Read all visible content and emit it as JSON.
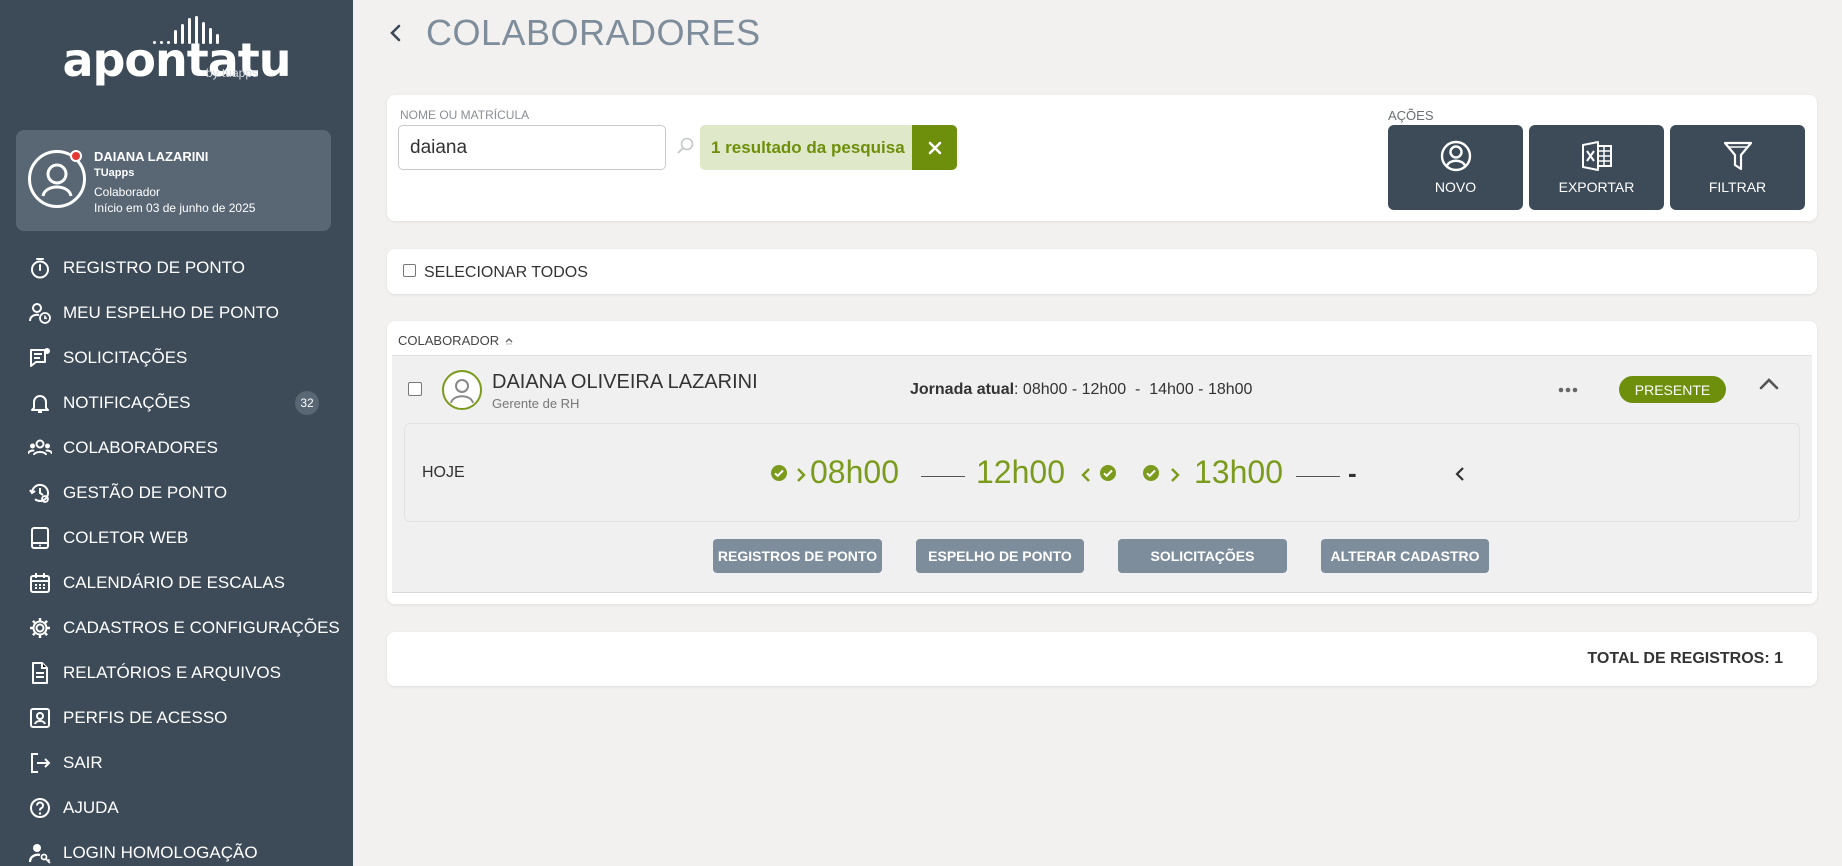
{
  "sidebar": {
    "logo_text": "apontatu",
    "logo_by": "by tuapps",
    "user": {
      "name": "DAIANA LAZARINI",
      "company": "TUapps",
      "role": "Colaborador",
      "since": "Início em 03 de junho de 2025"
    },
    "items": [
      {
        "label": "REGISTRO DE PONTO",
        "icon": "stopwatch-icon"
      },
      {
        "label": "MEU ESPELHO DE PONTO",
        "icon": "user-clock-icon"
      },
      {
        "label": "SOLICITAÇÕES",
        "icon": "request-icon"
      },
      {
        "label": "NOTIFICAÇÕES",
        "icon": "bell-icon",
        "badge": "32"
      },
      {
        "label": "COLABORADORES",
        "icon": "team-icon"
      },
      {
        "label": "GESTÃO DE PONTO",
        "icon": "clock-gear-icon"
      },
      {
        "label": "COLETOR WEB",
        "icon": "tablet-icon"
      },
      {
        "label": "CALENDÁRIO DE ESCALAS",
        "icon": "calendar-icon"
      },
      {
        "label": "CADASTROS E CONFIGURAÇÕES",
        "icon": "gear-icon"
      },
      {
        "label": "RELATÓRIOS E ARQUIVOS",
        "icon": "document-icon"
      },
      {
        "label": "PERFIS DE ACESSO",
        "icon": "id-card-icon"
      },
      {
        "label": "SAIR",
        "icon": "logout-icon"
      },
      {
        "label": "AJUDA",
        "icon": "help-icon"
      },
      {
        "label": "LOGIN HOMOLOGAÇÃO",
        "icon": "user-key-icon"
      }
    ]
  },
  "header": {
    "title": "COLABORADORES"
  },
  "search": {
    "label": "NOME OU MATRÍCULA",
    "value": "daiana",
    "result_text": "1 resultado da pesquisa"
  },
  "actions": {
    "label": "AÇÕES",
    "buttons": [
      {
        "label": "NOVO",
        "icon": "user-circle-icon"
      },
      {
        "label": "EXPORTAR",
        "icon": "excel-icon"
      },
      {
        "label": "FILTRAR",
        "icon": "filter-icon"
      }
    ]
  },
  "select_all_label": "SELECIONAR TODOS",
  "list": {
    "column_header": "COLABORADOR",
    "rows": [
      {
        "name": "DAIANA OLIVEIRA LAZARINI",
        "role": "Gerente de RH",
        "jornada_label": "Jornada atual",
        "jornada_value": ": 08h00 - 12h00  -  14h00 - 18h00",
        "status": "PRESENTE",
        "today_label": "HOJE",
        "punches": [
          "08h00",
          "12h00",
          "13h00",
          "-"
        ],
        "buttons": [
          "REGISTROS DE PONTO",
          "ESPELHO DE PONTO",
          "SOLICITAÇÕES",
          "ALTERAR CADASTRO"
        ]
      }
    ]
  },
  "total_text": "TOTAL DE REGISTROS: 1",
  "colors": {
    "sidebar_bg": "#3d4a57",
    "accent_green": "#6e8f0b",
    "title_gray": "#7d8d9c"
  }
}
